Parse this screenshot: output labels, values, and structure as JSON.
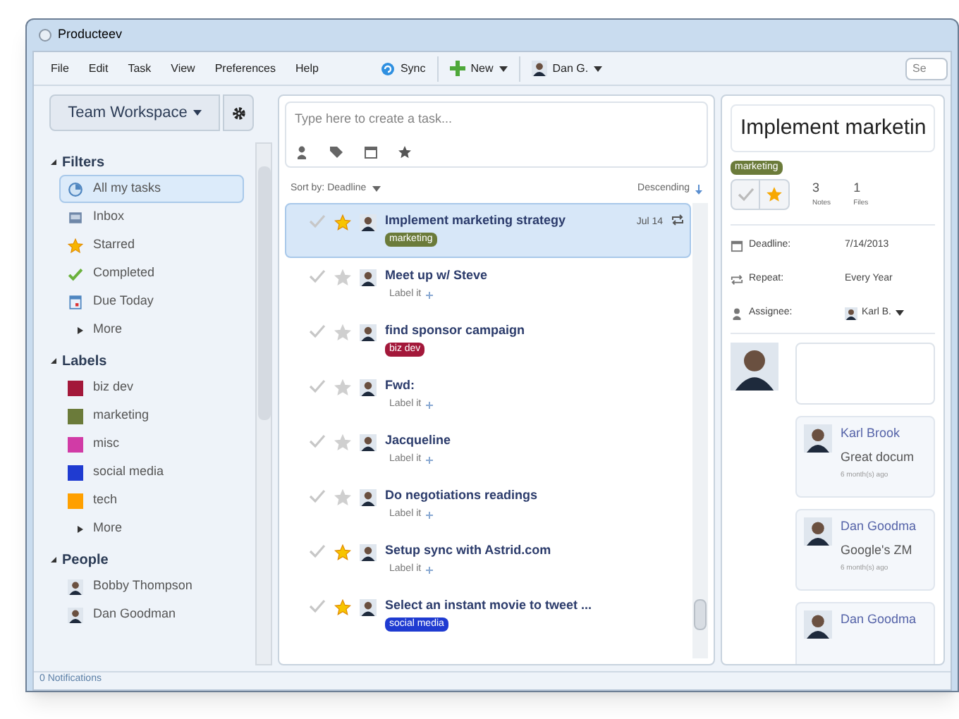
{
  "window": {
    "title": "Producteev"
  },
  "menu": [
    "File",
    "Edit",
    "Task",
    "View",
    "Preferences",
    "Help"
  ],
  "toolbar": [
    {
      "kind": "sync",
      "label": "Sync"
    },
    {
      "kind": "new",
      "label": "New"
    },
    {
      "kind": "user",
      "label": "Dan G."
    }
  ],
  "search": {
    "placeholder": "Se"
  },
  "sidebar": {
    "workspace": "Team Workspace",
    "sections": [
      {
        "title": "Filters",
        "expanded": true,
        "items": [
          {
            "kind": "filter",
            "label": "All my tasks",
            "selected": true
          },
          {
            "kind": "filter",
            "label": "Inbox",
            "selected": false
          },
          {
            "kind": "filter",
            "label": "Starred",
            "selected": false
          },
          {
            "kind": "filter",
            "label": "Completed",
            "selected": false
          },
          {
            "kind": "filter",
            "label": "Due Today",
            "selected": false
          },
          {
            "kind": "more",
            "label": "More",
            "selected": false
          }
        ]
      },
      {
        "title": "Labels",
        "expanded": true,
        "items": [
          {
            "kind": "label",
            "label": "biz dev",
            "color": "#a3183a",
            "selected": false
          },
          {
            "kind": "label",
            "label": "marketing",
            "color": "#6b7b3a",
            "selected": false
          },
          {
            "kind": "label",
            "label": "misc",
            "color": "#d13ba6",
            "selected": false
          },
          {
            "kind": "label",
            "label": "social media",
            "color": "#1f3bd1",
            "selected": false
          },
          {
            "kind": "label",
            "label": "tech",
            "color": "#ffa000",
            "selected": false
          },
          {
            "kind": "more",
            "label": "More",
            "selected": false
          }
        ]
      },
      {
        "title": "People",
        "expanded": true,
        "items": [
          {
            "kind": "person",
            "label": "Bobby Thompson",
            "selected": false
          },
          {
            "kind": "person",
            "label": "Dan Goodman",
            "selected": false
          }
        ]
      }
    ]
  },
  "status_bar": "0 Notifications",
  "composer": {
    "placeholder": "Type here to create a task..."
  },
  "sort": {
    "label": "Sort by: Deadline",
    "order": "Descending"
  },
  "tasks": [
    {
      "title": "Implement marketing strategy",
      "starred": true,
      "selected": true,
      "tag": {
        "text": "marketing",
        "color": "#6b7b3a"
      },
      "date": "Jul 14",
      "repeat": true
    },
    {
      "title": "Meet up w/ Steve",
      "starred": false,
      "selected": false,
      "label_it": "Label it"
    },
    {
      "title": "find sponsor campaign",
      "starred": false,
      "selected": false,
      "tag": {
        "text": "biz dev",
        "color": "#a3183a"
      }
    },
    {
      "title": "Fwd:",
      "starred": false,
      "selected": false,
      "label_it": "Label it"
    },
    {
      "title": "Jacqueline",
      "starred": false,
      "selected": false,
      "label_it": "Label it"
    },
    {
      "title": "Do negotiations readings",
      "starred": false,
      "selected": false,
      "label_it": "Label it"
    },
    {
      "title": "Setup sync with Astrid.com",
      "starred": true,
      "selected": false,
      "label_it": "Label it"
    },
    {
      "title": "Select an instant movie to tweet ...",
      "starred": true,
      "selected": false,
      "tag": {
        "text": "social media",
        "color": "#1f3bd1"
      }
    }
  ],
  "detail": {
    "title": "Implement marketin",
    "tag": {
      "text": "marketing",
      "color": "#6b7b3a"
    },
    "starred": true,
    "counts": [
      {
        "value": "3",
        "label": "Notes"
      },
      {
        "value": "1",
        "label": "Files"
      }
    ],
    "fields": [
      {
        "kind": "deadline",
        "label": "Deadline:",
        "value": "7/14/2013"
      },
      {
        "kind": "repeat",
        "label": "Repeat:",
        "value": "Every Year"
      },
      {
        "kind": "assignee",
        "label": "Assignee:",
        "value": "Karl B."
      }
    ],
    "comments": [
      {
        "author": "Karl Brook",
        "text": "Great docum",
        "time": "6 month(s) ago"
      },
      {
        "author": "Dan Goodma",
        "text": "Google's ZM",
        "time": "6 month(s) ago"
      },
      {
        "author": "Dan Goodma"
      }
    ]
  }
}
